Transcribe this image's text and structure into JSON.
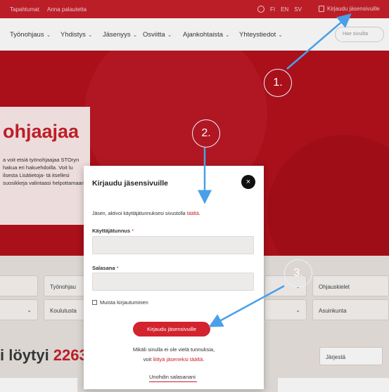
{
  "topbar": {
    "links": [
      "Tapahtumat",
      "Anna palautetta"
    ],
    "languages": [
      "FI",
      "EN",
      "SV"
    ],
    "login_label": "Kirjaudu jäsensivuille"
  },
  "nav": {
    "items": [
      "Työnohjaus",
      "Yhdistys",
      "Jäsenyys",
      "Osviitta",
      "Ajankohtaista",
      "Yhteystiedot"
    ],
    "search_placeholder": "Hae sivuilta"
  },
  "hero": {
    "title": "ohjaajaa",
    "text": "a voit etsiä työnohjaajaa STOryn hakua eri hakuehdoilla. Voit lu ilsesta Lisätietoja- tä itsellesi suosikkeja valintaasi helpottamaan."
  },
  "filters": {
    "row1": [
      "Työnohjau",
      "Ohjauskielet"
    ],
    "row2": [
      "Koulutusta",
      "Asuinkunta"
    ]
  },
  "results": {
    "prefix": "i löytyi ",
    "count": "2263",
    "sort_label": "Järjestä"
  },
  "modal": {
    "title": "Kirjaudu jäsensivuille",
    "close_icon": "×",
    "info_text": "Jäsen, aktivoi käyttäjätunnuksesi sivustolla ",
    "info_link": "täältä",
    "username_label": "Käyttäjätunnus",
    "password_label": "Salasana",
    "required_mark": "*",
    "remember_label": "Muista kirjautuminen",
    "submit_label": "Kirjaudu jäsensivuille",
    "no_account_text": "Mikäli sinulla ei ole vielä tunnuksia,",
    "join_prefix": "voit ",
    "join_link": "liittyä jäseneksi täältä",
    "join_suffix": ".",
    "forgot_label": "Unohdin salasanani"
  },
  "annotations": {
    "steps": [
      "1.",
      "2.",
      "3."
    ],
    "color": "#4aa0e8"
  },
  "colors": {
    "brand_red": "#c8202b",
    "button_red": "#d2232e"
  }
}
